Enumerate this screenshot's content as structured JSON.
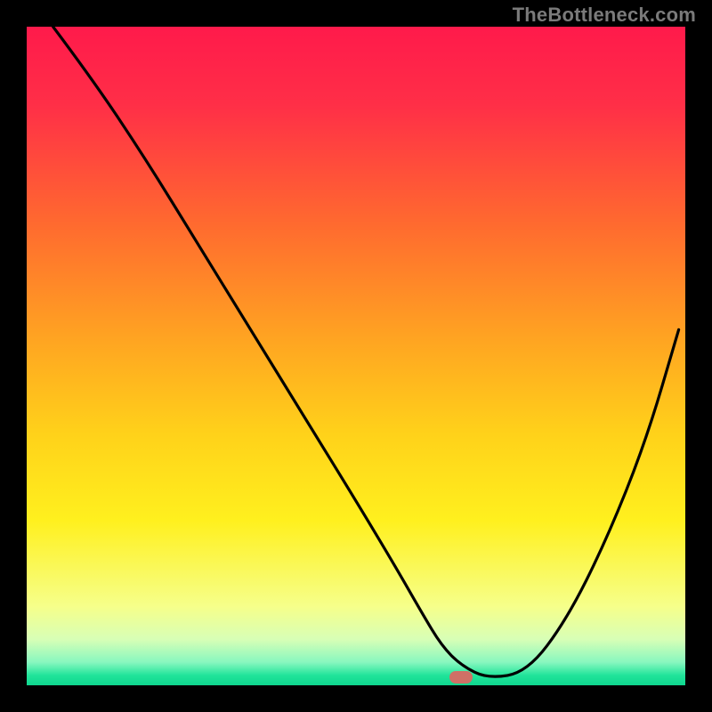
{
  "watermark": "TheBottleneck.com",
  "chart_data": {
    "type": "line",
    "title": "",
    "xlabel": "",
    "ylabel": "",
    "xlim": [
      0,
      100
    ],
    "ylim": [
      0,
      100
    ],
    "gradient_stops": [
      {
        "offset": 0.0,
        "color": "#ff1a4b"
      },
      {
        "offset": 0.12,
        "color": "#ff2f47"
      },
      {
        "offset": 0.3,
        "color": "#ff6a2f"
      },
      {
        "offset": 0.48,
        "color": "#ffa621"
      },
      {
        "offset": 0.62,
        "color": "#ffd21a"
      },
      {
        "offset": 0.75,
        "color": "#fff01e"
      },
      {
        "offset": 0.88,
        "color": "#f6ff8a"
      },
      {
        "offset": 0.93,
        "color": "#d8ffb6"
      },
      {
        "offset": 0.965,
        "color": "#88f7bf"
      },
      {
        "offset": 0.985,
        "color": "#20e49a"
      },
      {
        "offset": 1.0,
        "color": "#0fd68f"
      }
    ],
    "series": [
      {
        "name": "bottleneck-curve",
        "x": [
          4,
          10,
          18,
          26,
          34,
          42,
          50,
          56,
          60,
          63,
          66,
          70,
          76,
          82,
          88,
          94,
          99
        ],
        "y": [
          100,
          92,
          80,
          67,
          54,
          41,
          28,
          18,
          11,
          6,
          3,
          1,
          2,
          10,
          22,
          37,
          54
        ]
      }
    ],
    "marker": {
      "x": 66,
      "y": 1.2
    },
    "legend": []
  }
}
